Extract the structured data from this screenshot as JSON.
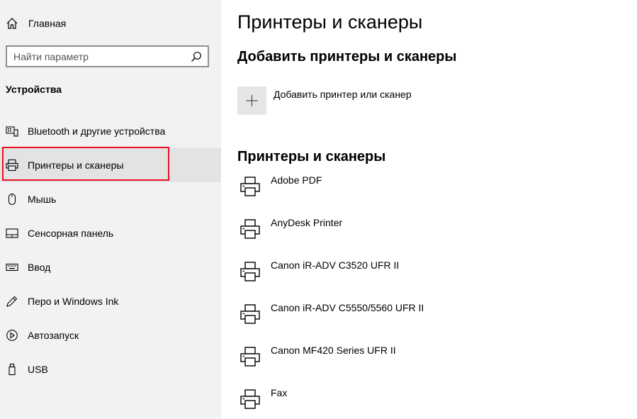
{
  "sidebar": {
    "home_label": "Главная",
    "search": {
      "placeholder": "Найти параметр"
    },
    "section_title": "Устройства",
    "items": [
      {
        "label": "Bluetooth и другие устройства",
        "icon": "bluetooth-devices-icon"
      },
      {
        "label": "Принтеры и сканеры",
        "icon": "printer-icon",
        "active": true
      },
      {
        "label": "Мышь",
        "icon": "mouse-icon"
      },
      {
        "label": "Сенсорная панель",
        "icon": "touchpad-icon"
      },
      {
        "label": "Ввод",
        "icon": "keyboard-icon"
      },
      {
        "label": "Перо и Windows Ink",
        "icon": "pen-icon"
      },
      {
        "label": "Автозапуск",
        "icon": "autoplay-icon"
      },
      {
        "label": "USB",
        "icon": "usb-icon"
      }
    ]
  },
  "main": {
    "title": "Принтеры и сканеры",
    "add_section_title": "Добавить принтеры и сканеры",
    "add_button_label": "Добавить принтер или сканер",
    "list_title": "Принтеры и сканеры",
    "printers": [
      "Adobe PDF",
      "AnyDesk Printer",
      "Canon iR-ADV C3520 UFR II",
      "Canon iR-ADV C5550/5560 UFR II",
      "Canon MF420 Series UFR II",
      "Fax"
    ]
  },
  "colors": {
    "sidebar_bg": "#f2f2f2",
    "active_item_bg": "#e3e3e3",
    "highlight_border": "#e81123",
    "add_button_bg": "#e6e6e6"
  }
}
